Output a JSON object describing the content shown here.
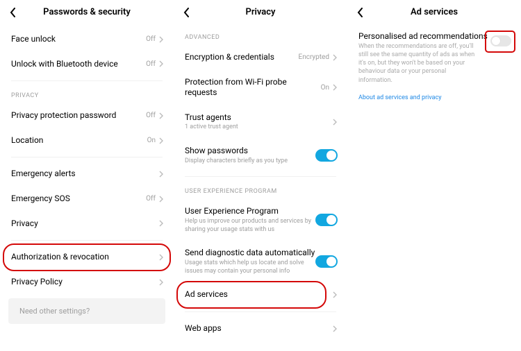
{
  "panel1": {
    "title": "Passwords & security",
    "rows": {
      "face_unlock": {
        "label": "Face unlock",
        "value": "Off"
      },
      "bt_unlock": {
        "label": "Unlock with Bluetooth device",
        "value": "Off"
      },
      "section_privacy": "PRIVACY",
      "pp_password": {
        "label": "Privacy protection password",
        "value": "Off"
      },
      "location": {
        "label": "Location",
        "value": "On"
      },
      "emerg_alerts": {
        "label": "Emergency alerts"
      },
      "emerg_sos": {
        "label": "Emergency SOS",
        "value": "Off"
      },
      "privacy": {
        "label": "Privacy"
      },
      "auth_rev": {
        "label": "Authorization & revocation"
      },
      "privacy_policy": {
        "label": "Privacy Policy"
      }
    },
    "footer": "Need other settings?"
  },
  "panel2": {
    "title": "Privacy",
    "section_advanced": "ADVANCED",
    "rows": {
      "enc": {
        "label": "Encryption & credentials",
        "value": "Encrypted"
      },
      "wifi_probe": {
        "label": "Protection from Wi-Fi probe requests",
        "value": "On"
      },
      "trust_agents": {
        "label": "Trust agents",
        "sub": "1 active trust agent"
      },
      "show_pw": {
        "label": "Show passwords",
        "sub": "Display characters briefly as you type"
      }
    },
    "section_uep": "USER EXPERIENCE PROGRAM",
    "uep": {
      "label": "User Experience Program",
      "sub": "Help us improve our products and services by sharing your usage stats with us"
    },
    "diag": {
      "label": "Send diagnostic data automatically",
      "sub": "Usage stats which help us locate and solve issues may contain your personal info"
    },
    "ad_services": {
      "label": "Ad services"
    },
    "web_apps": {
      "label": "Web apps"
    }
  },
  "panel3": {
    "title": "Ad services",
    "rec_title": "Personalised ad recommendations",
    "rec_desc": "When the recommendations are off, you'll still see the same quantity of ads as when it's on, but they won't be based on your behaviour data or your personal information.",
    "link": "About ad services and privacy"
  }
}
